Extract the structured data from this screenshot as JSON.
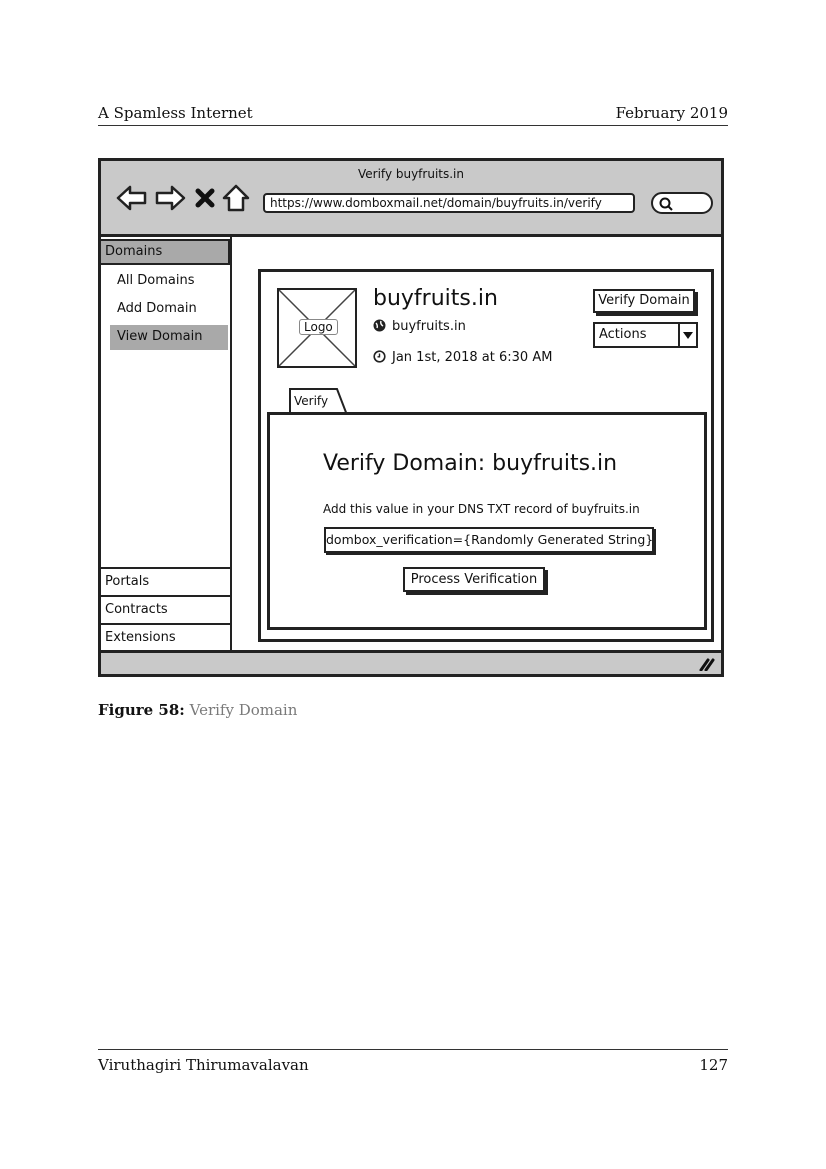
{
  "page_header": {
    "left": "A Spamless Internet",
    "right": "February 2019"
  },
  "page_footer": {
    "left": "Viruthagiri Thirumavalavan",
    "right": "127"
  },
  "browser": {
    "window_title": "Verify buyfruits.in",
    "url": "https://www.domboxmail.net/domain/buyfruits.in/verify",
    "icons": [
      "back-arrow-icon",
      "forward-arrow-icon",
      "close-x-icon",
      "home-icon",
      "search-icon",
      "resize-grip-icon"
    ]
  },
  "sidebar": {
    "header": "Domains",
    "items": [
      "All Domains",
      "Add Domain",
      "View Domain"
    ],
    "selected": "View Domain",
    "bottom_items": [
      "Portals",
      "Contracts",
      "Extensions"
    ]
  },
  "domain": {
    "logo_label": "Logo",
    "title": "buyfruits.in",
    "site": "buyfruits.in",
    "date": "Jan 1st, 2018 at 6:30 AM",
    "verify_button": "Verify Domain",
    "actions_label": "Actions"
  },
  "tab": {
    "label": "Verify",
    "heading": "Verify Domain: buyfruits.in",
    "description": "Add this value in your DNS TXT record of buyfruits.in",
    "value": "dombox_verification={Randomly Generated String}",
    "process_button": "Process Verification"
  },
  "caption": {
    "label": "Figure 58:",
    "text": "Verify Domain"
  },
  "colors": {
    "chrome_gray": "#c9c9c9",
    "selected_gray": "#a9a9a9",
    "outline": "#222222",
    "caption_gray": "#7a7a7a"
  }
}
